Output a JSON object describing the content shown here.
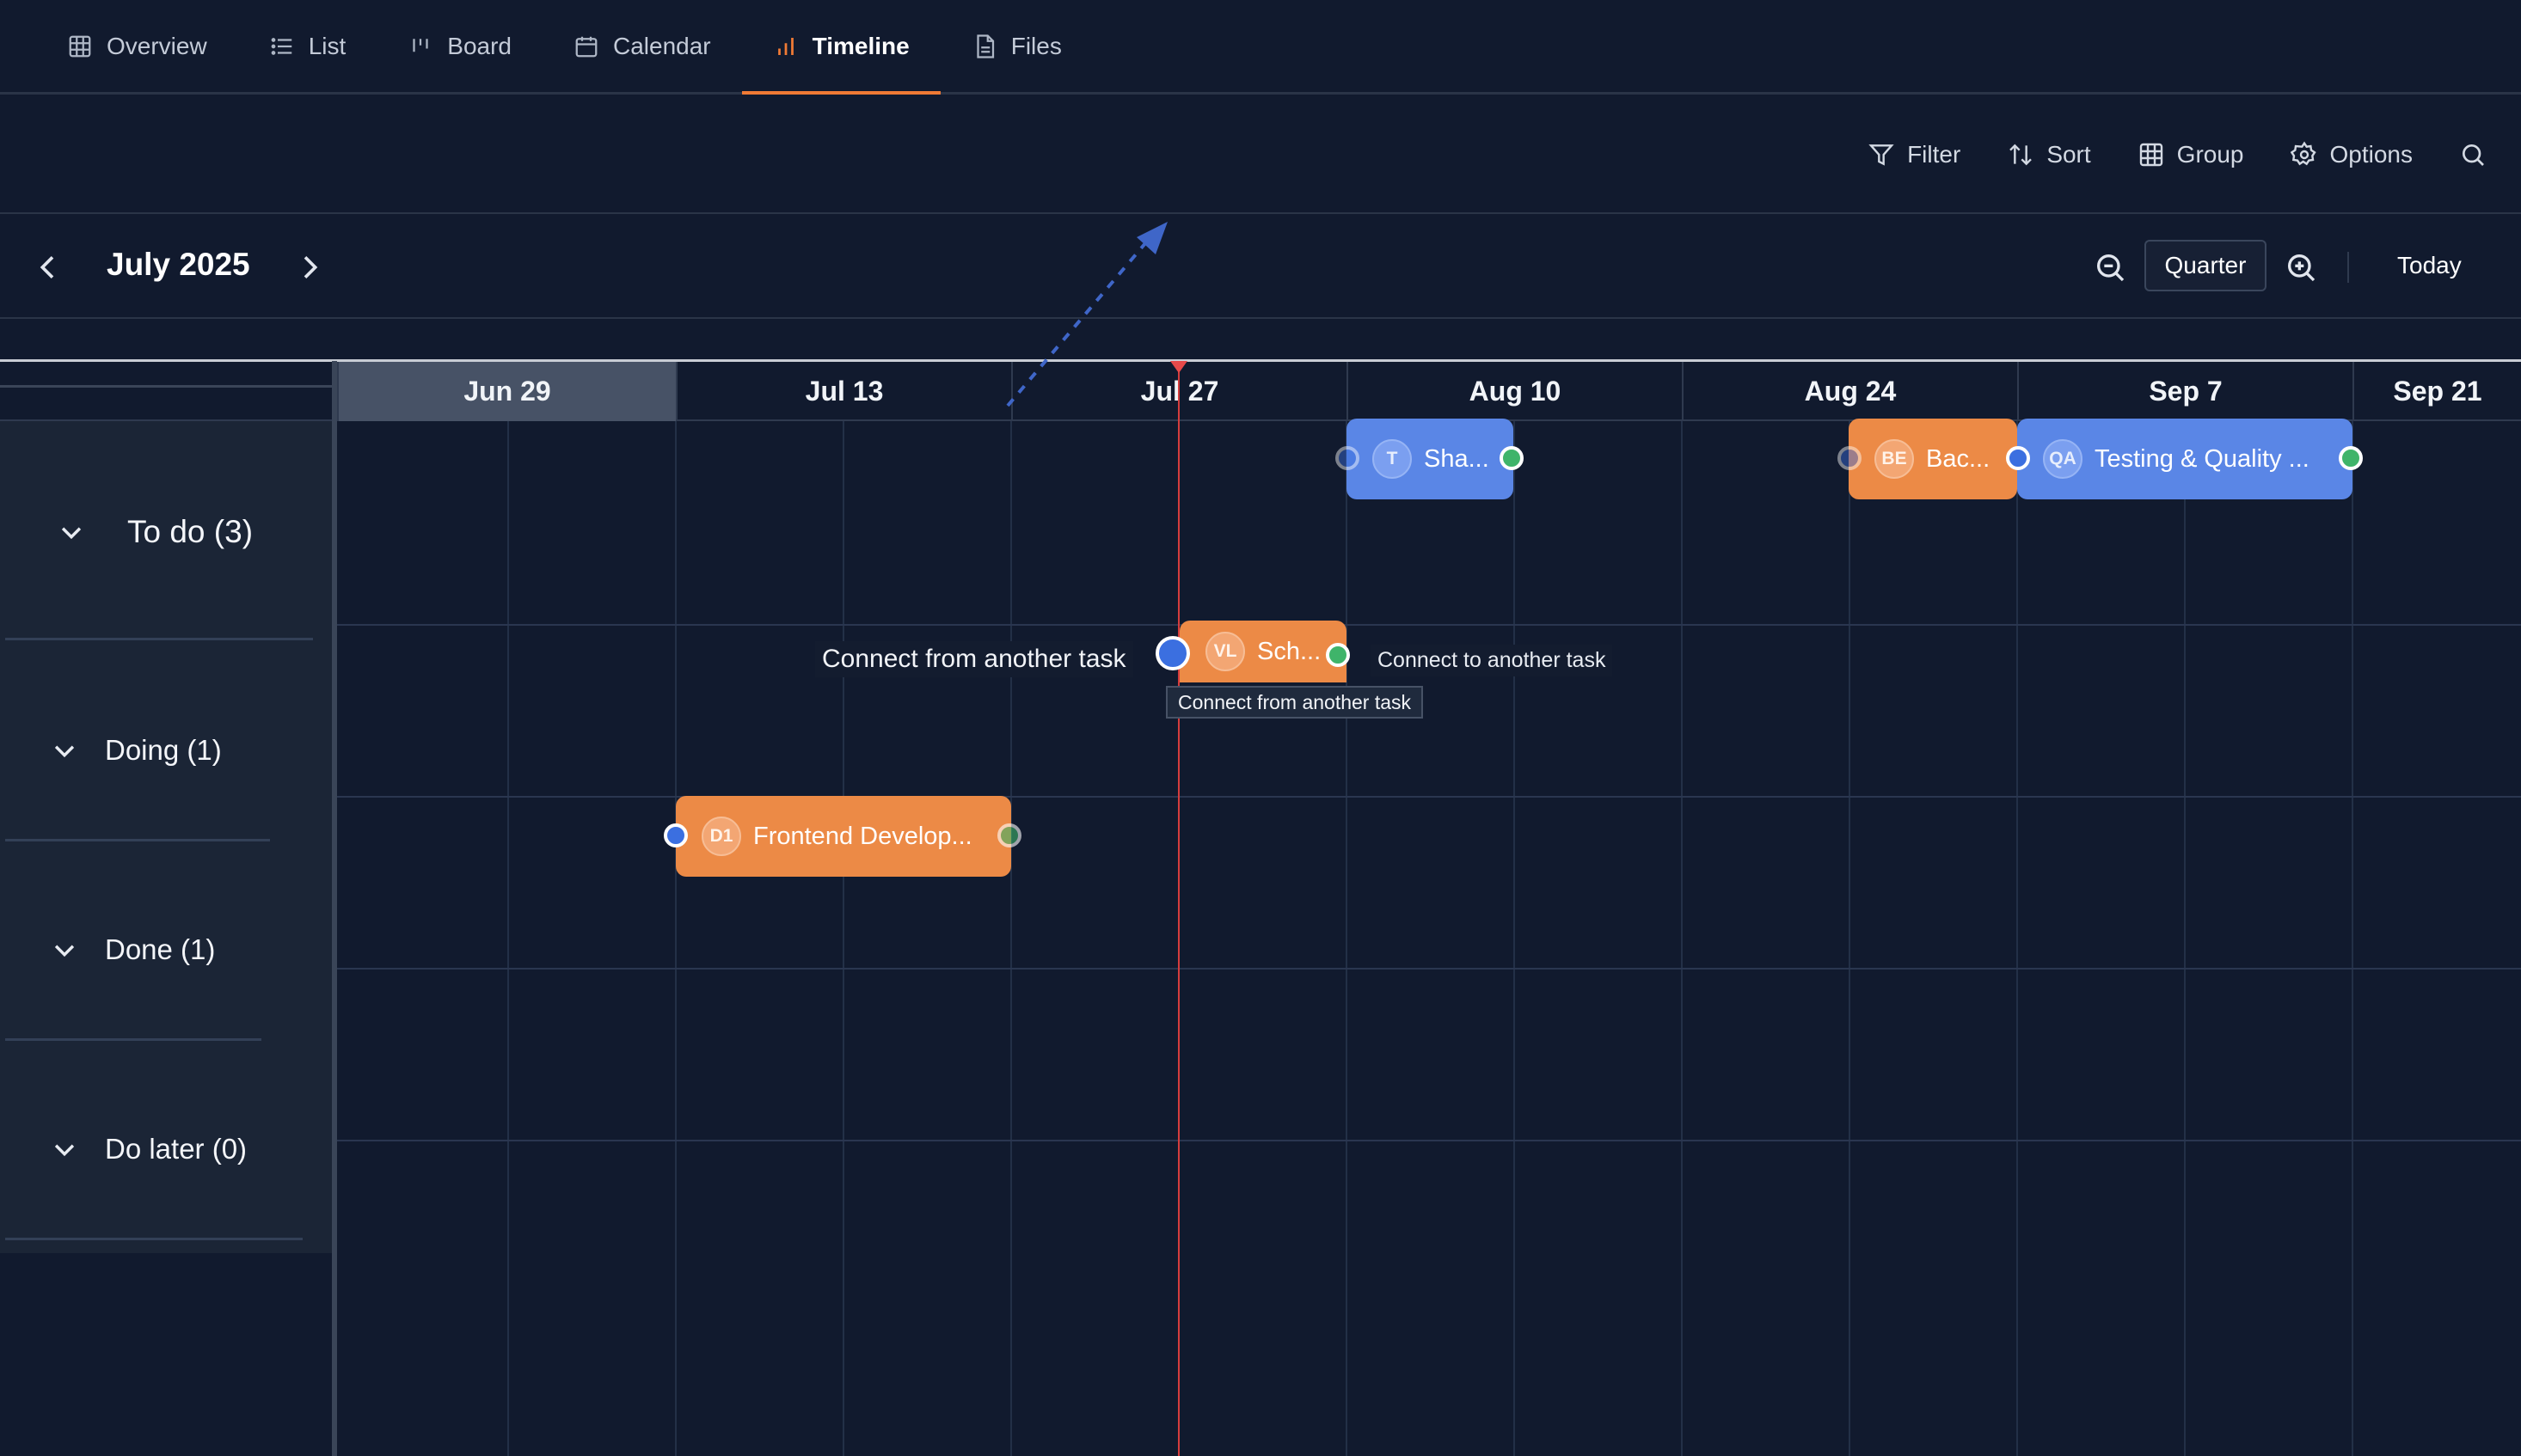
{
  "tabs": [
    {
      "label": "Overview",
      "icon": "grid-icon"
    },
    {
      "label": "List",
      "icon": "list-icon"
    },
    {
      "label": "Board",
      "icon": "board-icon"
    },
    {
      "label": "Calendar",
      "icon": "calendar-icon"
    },
    {
      "label": "Timeline",
      "icon": "timeline-icon",
      "active": true
    },
    {
      "label": "Files",
      "icon": "file-icon"
    }
  ],
  "toolbar": {
    "filter_label": "Filter",
    "sort_label": "Sort",
    "group_label": "Group",
    "options_label": "Options"
  },
  "nav": {
    "month": "July 2025",
    "scale": "Quarter",
    "today_label": "Today"
  },
  "timeline": {
    "dates": [
      "Jun 29",
      "Jul 13",
      "Jul 27",
      "Aug 10",
      "Aug 24",
      "Sep 7",
      "Sep 21"
    ],
    "current_week": "Jun 29"
  },
  "groups": [
    {
      "label": "To do (3)"
    },
    {
      "label": "Doing (1)"
    },
    {
      "label": "Done (1)"
    },
    {
      "label": "Do later (0)"
    }
  ],
  "tasks": [
    {
      "initials": "T",
      "label": "Sha...",
      "color": "blue",
      "group": "To do"
    },
    {
      "initials": "BE",
      "label": "Bac...",
      "color": "orange",
      "group": "To do"
    },
    {
      "initials": "QA",
      "label": "Testing & Quality ...",
      "color": "blue",
      "group": "To do"
    },
    {
      "initials": "VL",
      "label": "Sch...",
      "color": "orange",
      "group": "Doing"
    },
    {
      "initials": "D1",
      "label": "Frontend Develop...",
      "color": "orange",
      "group": "Done"
    }
  ],
  "hints": {
    "connect_from": "Connect from another task",
    "connect_to": "Connect to another task",
    "tooltip": "Connect from another task"
  },
  "colors": {
    "background": "#111a2e",
    "accent": "#f07a35",
    "task_blue": "#5a86e6",
    "task_orange": "#ec8a46",
    "today_line": "#d63d3d"
  }
}
